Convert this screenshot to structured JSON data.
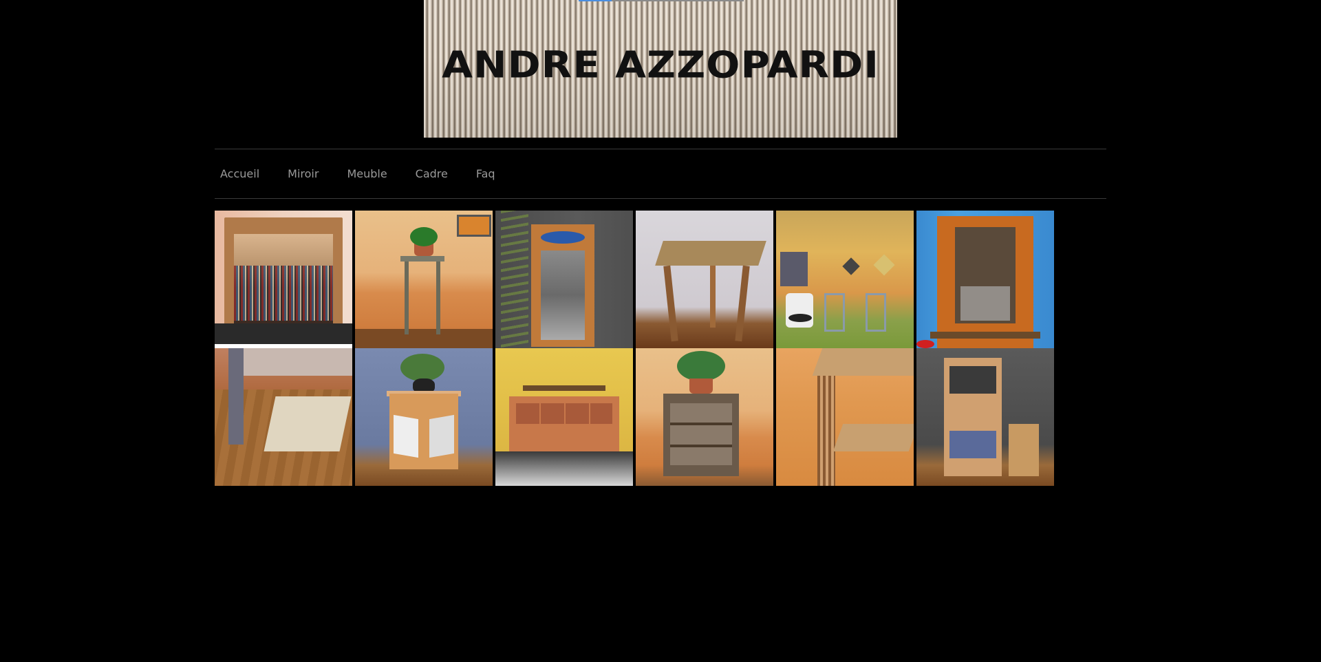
{
  "header": {
    "banner_title": "ANDRE AZZOPARDI"
  },
  "nav": {
    "items": [
      {
        "label": "Accueil"
      },
      {
        "label": "Miroir"
      },
      {
        "label": "Meuble"
      },
      {
        "label": "Cadre"
      },
      {
        "label": "Faq"
      }
    ]
  },
  "colors": {
    "background": "#000000",
    "nav_text": "#9a9a9a",
    "nav_border": "#3a3a3a"
  },
  "gallery": {
    "thumbnails": [
      {
        "icon": "mirror-photo"
      },
      {
        "icon": "plant-stand-photo"
      },
      {
        "icon": "tall-mirror-photo"
      },
      {
        "icon": "side-table-photo"
      },
      {
        "icon": "bathroom-photo"
      },
      {
        "icon": "display-cabinet-photo"
      },
      {
        "icon": "table-detail-photo"
      },
      {
        "icon": "small-cabinet-photo"
      },
      {
        "icon": "headboard-photo"
      },
      {
        "icon": "shelf-unit-photo"
      },
      {
        "icon": "table-corner-photo"
      },
      {
        "icon": "dresser-photo"
      }
    ]
  }
}
